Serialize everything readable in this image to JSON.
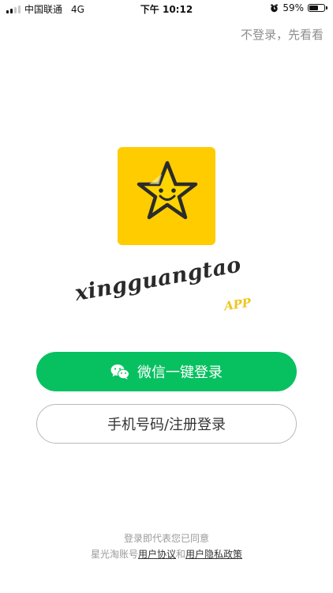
{
  "status_bar": {
    "carrier": "中国联通",
    "network": "4G",
    "time": "下午 10:12",
    "battery_percent": "59%",
    "battery_level": 0.59
  },
  "header": {
    "skip_label": "不登录，先看看"
  },
  "brand": {
    "logo_icon": "smiling-star-icon",
    "wordmark": "xingguangtao",
    "app_tag": "APP",
    "colors": {
      "logo_bg": "#ffcc00",
      "star_fill": "#ffd500",
      "app_tag": "#f0c419"
    }
  },
  "actions": {
    "wechat_login_label": "微信一键登录",
    "wechat_icon": "wechat-icon",
    "wechat_color": "#07c160",
    "phone_login_label": "手机号码/注册登录"
  },
  "agreement": {
    "line1": "登录即代表您已同意",
    "prefix": "星光淘账号",
    "user_agreement": "用户协议",
    "conjunction": "和",
    "privacy_policy": "用户隐私政策"
  }
}
